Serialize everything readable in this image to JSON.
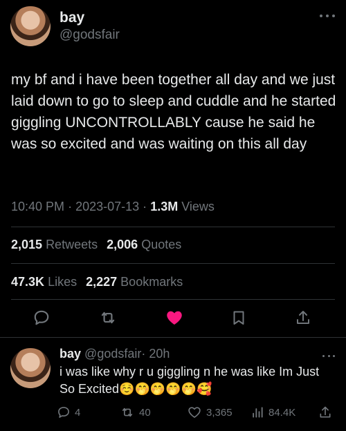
{
  "tweet": {
    "display_name": "bay",
    "handle": "@godsfair",
    "text": "my bf and i have been together all day and we just laid down to go to sleep and cuddle and he started giggling UNCONTROLLABLY cause he said he was so excited and was waiting on this all day",
    "time": "10:40 PM",
    "separator": "·",
    "date": "2023-07-13",
    "views_count": "1.3M",
    "views_label": "Views",
    "retweets_count": "2,015",
    "retweets_label": "Retweets",
    "quotes_count": "2,006",
    "quotes_label": "Quotes",
    "likes_count": "47.3K",
    "likes_label": "Likes",
    "bookmarks_count": "2,227",
    "bookmarks_label": "Bookmarks"
  },
  "reply": {
    "display_name": "bay",
    "handle": "@godsfair",
    "separator": "·",
    "time": "20h",
    "text": "i was like why r u giggling n he was like Im Just So Excited☺️🤭🤭🤭🤭🥰",
    "replies": "4",
    "retweets": "40",
    "likes": "3,365",
    "views": "84.4K"
  },
  "colors": {
    "background": "#000000",
    "text": "#e7e9ea",
    "secondary": "#71767b",
    "like_pink": "#f91880",
    "divider": "#2f3336"
  },
  "icons": {
    "more": "more-icon",
    "reply": "reply-icon",
    "retweet": "retweet-icon",
    "like": "heart-icon",
    "bookmark": "bookmark-icon",
    "share": "share-icon",
    "views": "views-icon"
  }
}
